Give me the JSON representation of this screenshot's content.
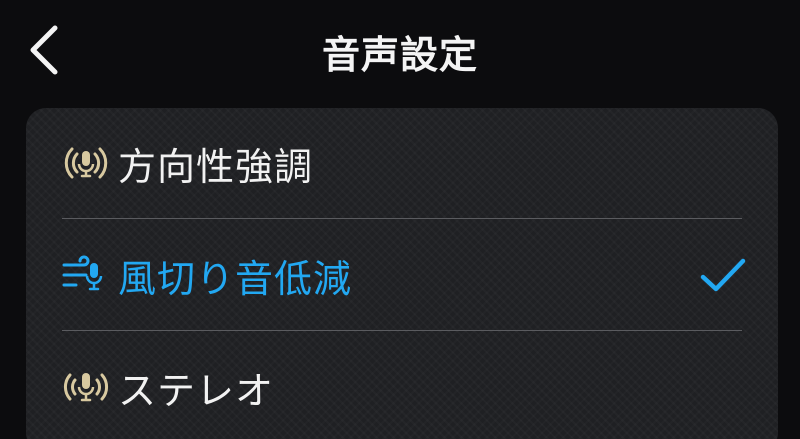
{
  "header": {
    "title": "音声設定",
    "back_icon": "chevron-left-icon"
  },
  "options": [
    {
      "label": "方向性強調",
      "icon": "directional-mic-icon",
      "selected": false
    },
    {
      "label": "風切り音低減",
      "icon": "wind-reduction-mic-icon",
      "selected": true
    },
    {
      "label": "ステレオ",
      "icon": "stereo-mic-icon",
      "selected": false
    }
  ],
  "colors": {
    "accent": "#22a8f2",
    "icon_gold": "#d8c9a0",
    "text": "#f2f2f2",
    "panel": "#1f2023",
    "background": "#0c0c0e"
  }
}
